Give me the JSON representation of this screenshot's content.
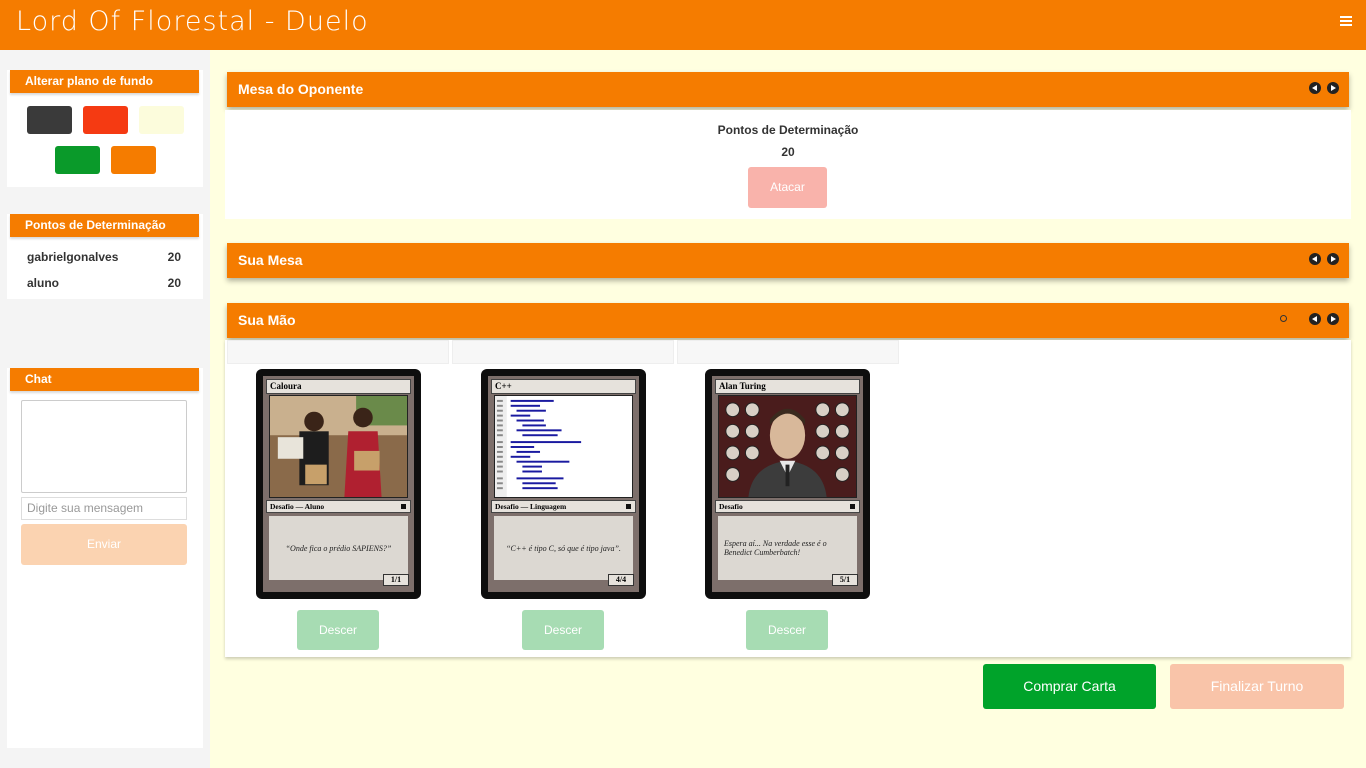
{
  "app": {
    "title": "Lord Of Florestal - Duelo"
  },
  "background_panel": {
    "title": "Alterar plano de fundo",
    "swatches": [
      "#3a3a3a",
      "#f53a12",
      "#fcfcdc",
      "#0a9a2a",
      "#f57c00"
    ]
  },
  "scores_panel": {
    "title": "Pontos de Determinação",
    "rows": [
      {
        "name": "gabrielgonalves",
        "points": "20"
      },
      {
        "name": "aluno",
        "points": "20"
      }
    ]
  },
  "chat": {
    "title": "Chat",
    "placeholder": "Digite sua mensagem",
    "send_label": "Enviar"
  },
  "opponent": {
    "title": "Mesa do Oponente",
    "points_label": "Pontos de Determinação",
    "points_value": "20",
    "attack_label": "Atacar"
  },
  "your_table": {
    "title": "Sua Mesa"
  },
  "hand": {
    "title": "Sua Mão",
    "cards": [
      {
        "name": "Caloura",
        "type": "Desafio — Aluno",
        "text": "“Onde fica o prédio SAPIENS?”",
        "power": "1/1",
        "action_label": "Descer"
      },
      {
        "name": "C++",
        "type": "Desafio — Linguagem",
        "text": "“C++ é tipo C, só que é tipo java”.",
        "power": "4/4",
        "action_label": "Descer"
      },
      {
        "name": "Alan Turing",
        "type": "Desafio",
        "text": "Espera aí... Na verdade esse é o Benedict Cumberbatch!",
        "power": "5/1",
        "action_label": "Descer"
      }
    ]
  },
  "actions": {
    "buy_card_label": "Comprar Carta",
    "end_turn_label": "Finalizar Turno"
  },
  "colors": {
    "brand_orange": "#f57c00",
    "page_background": "#ffffe0",
    "buy_green": "#00a32a"
  }
}
